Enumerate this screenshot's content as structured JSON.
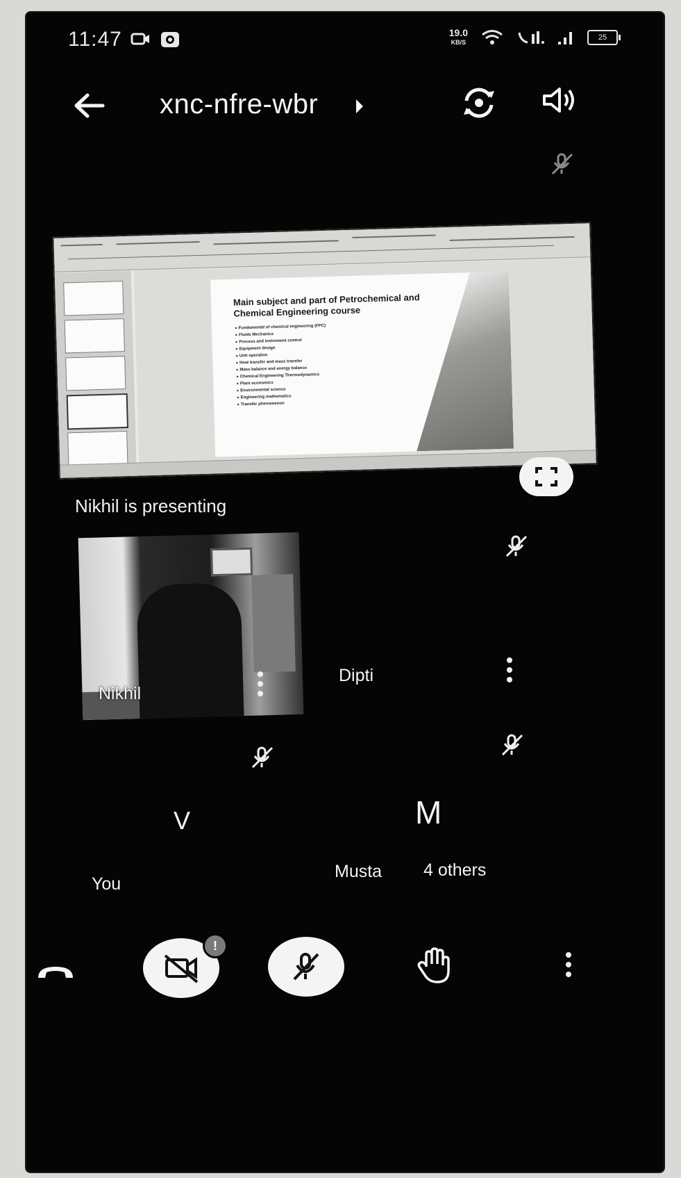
{
  "status_bar": {
    "time": "11:47",
    "net_speed_value": "19.0",
    "net_speed_unit": "KB/S",
    "battery": "25"
  },
  "header": {
    "meeting_code": "xnc-nfre-wbr"
  },
  "presentation": {
    "slide_title": "Main subject and part of Petrochemical and Chemical Engineering course",
    "slide_items": [
      "Fundamental of chemical engineering (FPC)",
      "Fluids Mechanics",
      "Process and instrument control",
      "Equipment design",
      "Unit operation",
      "Heat transfer and mass transfer",
      "Mass balance and energy balance",
      "Chemical Engineering Thermodynamics",
      "Plant economics",
      "Environmental science",
      "Engineering mathematics",
      "Transfer phenomenon"
    ],
    "presenting_text": "Nikhil is presenting"
  },
  "participants": {
    "nikhil": {
      "name": "Nikhil"
    },
    "dipti": {
      "name": "Dipti"
    },
    "you": {
      "initial": "V",
      "name": "You"
    },
    "group": {
      "initial": "M",
      "name": "Musta",
      "others": "4 others"
    }
  },
  "controls": {
    "camera_badge": "!"
  },
  "icons": {
    "back": "arrow-left-icon",
    "switch_camera": "switch-camera-icon",
    "audio": "speaker-icon",
    "fullscreen": "fullscreen-icon",
    "mic_off": "mic-off-icon",
    "more": "more-vertical-icon",
    "hangup": "phone-hangup-icon",
    "camera_off": "camera-off-icon",
    "raise_hand": "hand-icon"
  },
  "colors": {
    "background": "#050505",
    "foreground": "#f2f2f2",
    "button_bg": "#f4f4f4"
  }
}
